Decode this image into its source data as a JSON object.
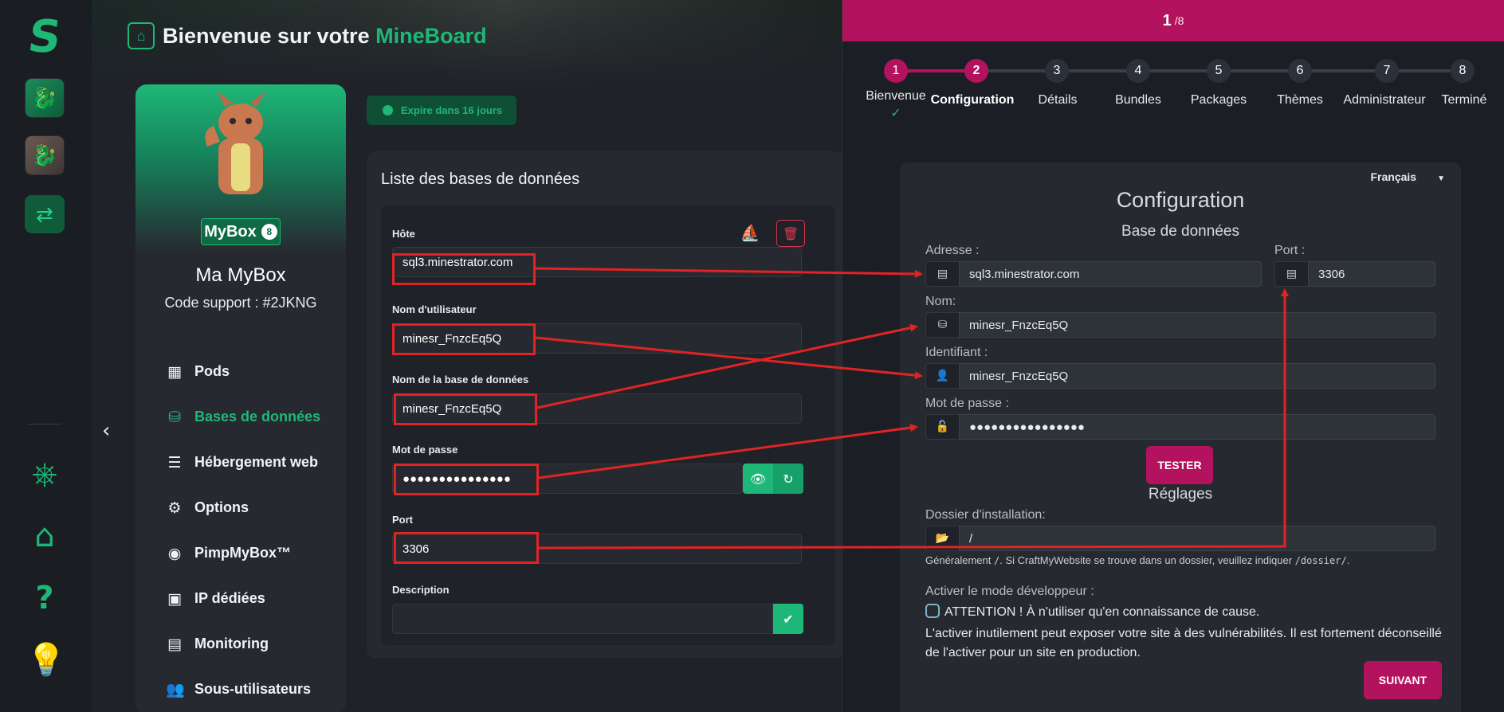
{
  "app": {
    "title_prefix": "Bienvenue sur votre ",
    "title_brand": "MineBoard",
    "expire_text": "Expire dans 16 jours"
  },
  "profile": {
    "badge_name": "MyBox",
    "badge_count": "8",
    "name": "Ma MyBox",
    "support_code": "Code support : #2JKNG"
  },
  "menu": [
    {
      "label": "Pods",
      "icon": "boxes-icon"
    },
    {
      "label": "Bases de données",
      "icon": "database-icon",
      "active": true
    },
    {
      "label": "Hébergement web",
      "icon": "server-icon"
    },
    {
      "label": "Options",
      "icon": "gear-icon"
    },
    {
      "label": "PimpMyBox™",
      "icon": "gamepad-icon"
    },
    {
      "label": "IP dédiées",
      "icon": "ip-icon"
    },
    {
      "label": "Monitoring",
      "icon": "chart-icon"
    },
    {
      "label": "Sous-utilisateurs",
      "icon": "users-icon"
    }
  ],
  "db": {
    "heading": "Liste des bases de données",
    "host_label": "Hôte",
    "host": "sql3.minestrator.com",
    "user_label": "Nom d'utilisateur",
    "user": "minesr_FnzcEq5Q",
    "dbname_label": "Nom de la base de données",
    "dbname": "minesr_FnzcEq5Q",
    "password_label": "Mot de passe",
    "password": "●●●●●●●●●●●●●●●",
    "port_label": "Port",
    "port": "3306",
    "description_label": "Description",
    "description": ""
  },
  "wizard": {
    "progress_current": "1",
    "progress_total": "/8",
    "steps": [
      {
        "num": "1",
        "label": "Bienvenue"
      },
      {
        "num": "2",
        "label": "Configuration"
      },
      {
        "num": "3",
        "label": "Détails"
      },
      {
        "num": "4",
        "label": "Bundles"
      },
      {
        "num": "5",
        "label": "Packages"
      },
      {
        "num": "6",
        "label": "Thèmes"
      },
      {
        "num": "7",
        "label": "Administrateur"
      },
      {
        "num": "8",
        "label": "Terminé"
      }
    ],
    "language": "Français",
    "title": "Configuration",
    "db_section": "Base de données",
    "address_label": "Adresse :",
    "address": "sql3.minestrator.com",
    "port_label": "Port :",
    "port": "3306",
    "name_label": "Nom:",
    "name": "minesr_FnzcEq5Q",
    "login_label": "Identifiant :",
    "login": "minesr_FnzcEq5Q",
    "password_label": "Mot de passe :",
    "password": "●●●●●●●●●●●●●●●●",
    "test_button": "TESTER",
    "settings_section": "Réglages",
    "install_dir_label": "Dossier d'installation:",
    "install_dir": "/",
    "hint_before": "Généralement ",
    "hint_code1": "/",
    "hint_middle": ". Si CraftMyWebsite se trouve dans un dossier, veuillez indiquer ",
    "hint_code2": "/dossier/",
    "hint_after": ".",
    "dev_label": "Activer le mode développeur :",
    "warn_line1": "ATTENTION ! À n'utiliser qu'en connaissance de cause.",
    "warn_line2": "L'activer inutilement peut exposer votre site à des vulnérabilités. Il est fortement déconseillé de l'activer pour un site en production.",
    "next_button": "SUIVANT"
  },
  "colors": {
    "accent_green": "#1fb778",
    "accent_pink": "#b3135e",
    "arrow_red": "#e02424"
  }
}
